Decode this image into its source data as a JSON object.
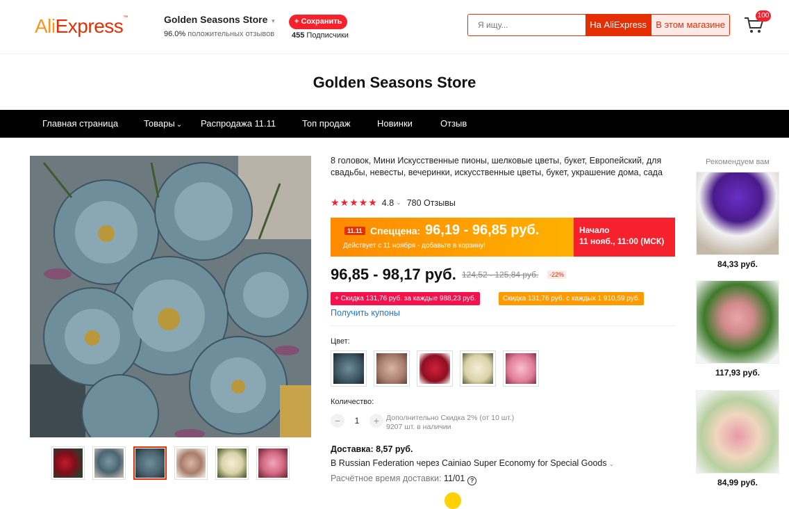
{
  "header": {
    "logo_text_a": "Ali",
    "logo_text_b": "Express",
    "store_name": "Golden Seasons Store",
    "positive_pct": "96.0%",
    "positive_label": "положительных отзывов",
    "save_label": "+ Сохранить",
    "subscribers_count": "455",
    "subscribers_label": "Подписчики",
    "search_placeholder": "Я ищу...",
    "search_ali_label": "На AliExpress",
    "search_store_label": "В этом магазине",
    "cart_count": "100"
  },
  "banner": {
    "title": "Golden Seasons Store"
  },
  "nav": {
    "items": [
      "Главная страница",
      "Товары",
      "Распродажа 11.11",
      "Топ продаж",
      "Новинки",
      "Отзыв"
    ]
  },
  "product": {
    "title": "8 головок, Мини Искусственные пионы, шелковые цветы, букет, Европейский, для свадьбы, невесты, вечеринки, искусственные цветы, букет, украшение дома, сада",
    "stars": "★★★★★",
    "rating": "4.8",
    "reviews": "780 Отзывы",
    "promo_tag": "11.11",
    "promo_label": "Спеццена:",
    "promo_price": "96,19 - 96,85 руб.",
    "promo_sub": "Действует с 11 ноября - добавьте в корзину!",
    "promo_start_label": "Начало",
    "promo_start_time": "11 нояб., 11:00 (МСК)",
    "price": "96,85 - 98,17 руб.",
    "old_price": "124,52 - 125,84 руб.",
    "discount": "-22%",
    "coupon1": "+ Скидка 131,76 руб. за каждые 988,23 руб.",
    "coupon2": "Скидка 131,76 руб. с каждых 1 910,59 руб.",
    "get_coupons": "Получить купоны",
    "color_label": "Цвет:",
    "quantity_label": "Количество:",
    "quantity_value": "1",
    "qty_discount": "Дополнительно Скидка 2% (от 10 шт.)",
    "stock": "9207 шт. в наличии",
    "shipping_price": "Доставка: 8,57 руб.",
    "shipping_method": "В Russian Federation через Cainiao Super Economy for Special Goods",
    "delivery_label": "Расчётное время доставки:",
    "delivery_date": "11/01"
  },
  "recommend": {
    "title": "Рекомендуем вам",
    "items": [
      {
        "price": "84,33 руб."
      },
      {
        "price": "117,93 руб."
      },
      {
        "price": "84,99 руб."
      }
    ]
  },
  "colors": {
    "accent": "#e62e04",
    "promo_orange": "#ff8a00",
    "promo_red": "#f5222d",
    "link_blue": "#1a74d8"
  }
}
